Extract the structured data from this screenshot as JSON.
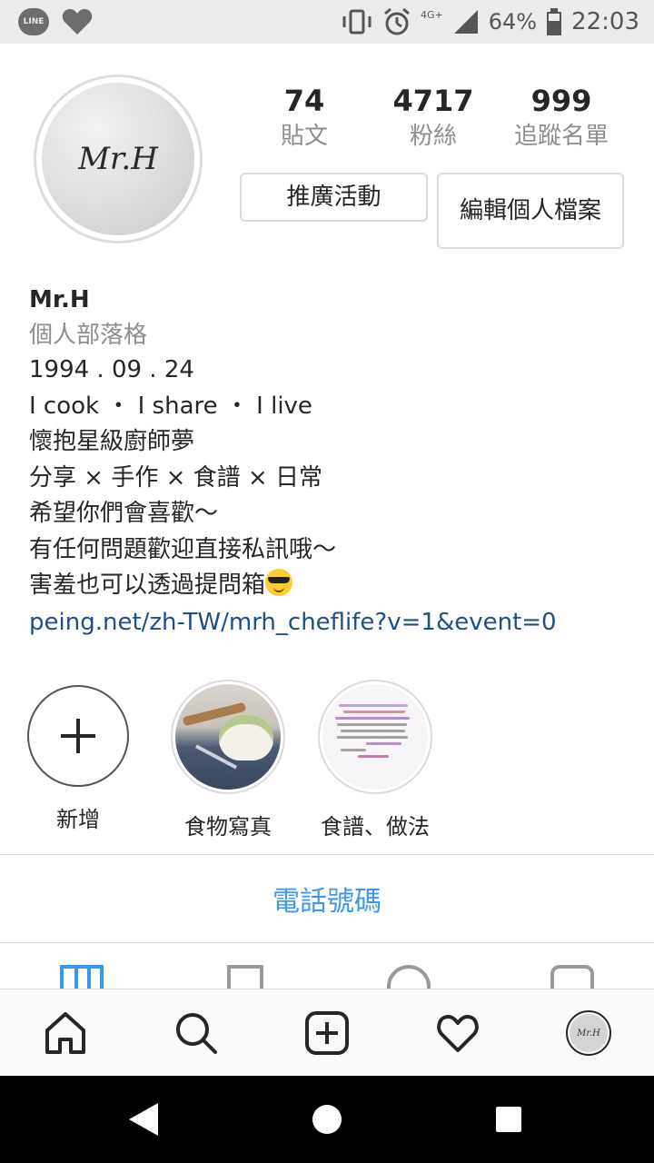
{
  "status_bar": {
    "line_badge": "LINE",
    "network": "4G+",
    "battery_percent": "64%",
    "time": "22:03",
    "icons": [
      "line-icon",
      "heart-icon",
      "vibrate-icon",
      "alarm-icon",
      "signal-icon",
      "battery-icon"
    ]
  },
  "profile": {
    "avatar_text": "Mr.H",
    "stats": {
      "posts": {
        "value": "74",
        "label": "貼文"
      },
      "followers": {
        "value": "4717",
        "label": "粉絲"
      },
      "following": {
        "value": "999",
        "label": "追蹤名單"
      }
    },
    "buttons": {
      "promotions": "推廣活動",
      "edit_profile": "編輯個人檔案"
    }
  },
  "bio": {
    "name": "Mr.H",
    "category": "個人部落格",
    "lines": [
      "1994 . 09 . 24",
      "I cook  ・ I share  ・ I live",
      "懷抱星級廚師夢",
      "分享 × 手作 × 食譜 × 日常",
      "希望你們會喜歡～",
      "有任何問題歡迎直接私訊哦～",
      "害羞也可以透過提問箱"
    ],
    "link": "peing.net/zh-TW/mrh_cheflife?v=1&event=0"
  },
  "highlights": [
    {
      "label": "新增"
    },
    {
      "label": "食物寫真"
    },
    {
      "label": "食譜、做法"
    }
  ],
  "contact_button": "電話號碼",
  "tabs": [
    "grid-icon",
    "igtv-icon",
    "saved-icon",
    "tagged-icon"
  ],
  "bottom_nav": {
    "avatar_text": "Mr.H",
    "items": [
      "home-icon",
      "search-icon",
      "new-post-icon",
      "activity-heart-icon",
      "profile-avatar"
    ]
  },
  "colors": {
    "link_blue": "#3897f0",
    "bio_link": "#1d4f8a",
    "muted": "#8e8e8e"
  }
}
